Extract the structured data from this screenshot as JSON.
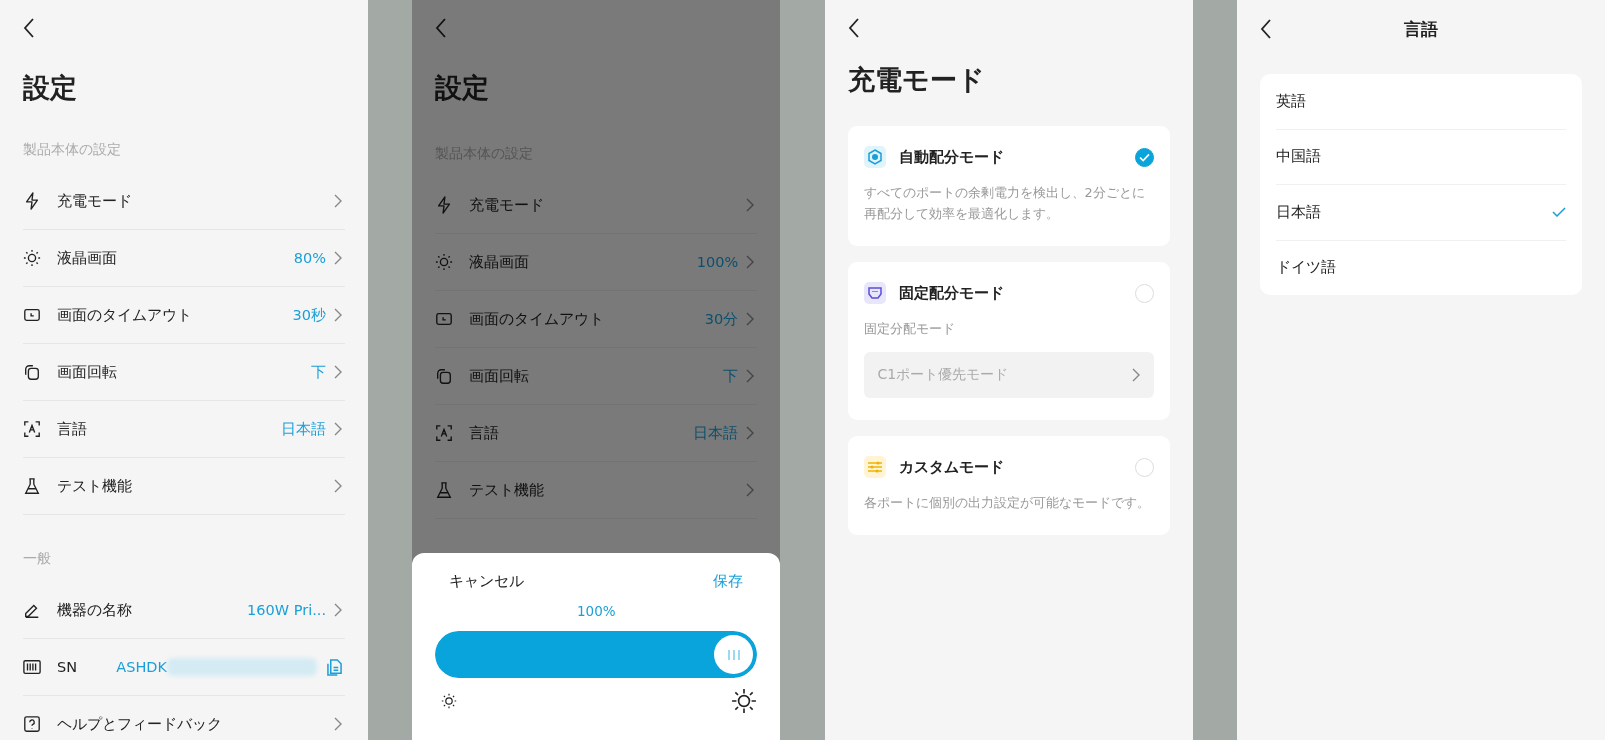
{
  "screens": [
    {
      "kind": "settings",
      "title": "設定",
      "sections": [
        {
          "header": "製品本体の設定",
          "items": [
            {
              "kind": "link",
              "label": "充電モード"
            },
            {
              "kind": "link",
              "label": "液晶画面",
              "value": "80%"
            },
            {
              "kind": "link",
              "label": "画面のタイムアウト",
              "value": "30秒"
            },
            {
              "kind": "link",
              "label": "画面回転",
              "value": "下"
            },
            {
              "kind": "link",
              "label": "言語",
              "value": "日本語"
            },
            {
              "kind": "link",
              "label": "テスト機能"
            }
          ]
        },
        {
          "header": "一般",
          "items": [
            {
              "kind": "link",
              "label": "機器の名称",
              "value": "160W Pri..."
            },
            {
              "kind": "serial",
              "label": "SN",
              "value": "ASHDK"
            },
            {
              "kind": "link",
              "label": "ヘルプとフィードバック"
            }
          ]
        }
      ]
    },
    {
      "kind": "settings",
      "title": "設定",
      "dimmed": true,
      "sections": [
        {
          "header": "製品本体の設定",
          "items": [
            {
              "kind": "link",
              "label": "充電モード"
            },
            {
              "kind": "link",
              "label": "液晶画面",
              "value": "100%"
            },
            {
              "kind": "link",
              "label": "画面のタイムアウト",
              "value": "30分"
            },
            {
              "kind": "link",
              "label": "画面回転",
              "value": "下"
            },
            {
              "kind": "link",
              "label": "言語",
              "value": "日本語"
            },
            {
              "kind": "link",
              "label": "テスト機能"
            }
          ]
        }
      ],
      "sheet": {
        "cancel": "キャンセル",
        "save": "保存",
        "reading": "100%",
        "level": 1.0
      }
    },
    {
      "kind": "modes",
      "title": "充電モード",
      "cards": [
        {
          "kind": "description",
          "title": "自動配分モード",
          "selected": true,
          "description": "すべてのポートの余剰電力を検出し、2分ごとに再配分して効率を最適化します。"
        },
        {
          "kind": "select",
          "title": "固定配分モード",
          "selected": false,
          "sub_label": "固定分配モード",
          "select_value": "C1ポート優先モード"
        },
        {
          "kind": "description",
          "title": "カスタムモード",
          "selected": false,
          "description": "各ポートに個別の出力設定が可能なモードです。"
        }
      ]
    },
    {
      "kind": "language",
      "title": "言語",
      "options": [
        {
          "label": "英語",
          "selected": false
        },
        {
          "label": "中国語",
          "selected": false
        },
        {
          "label": "日本語",
          "selected": true
        },
        {
          "label": "ドイツ語",
          "selected": false
        }
      ]
    }
  ]
}
